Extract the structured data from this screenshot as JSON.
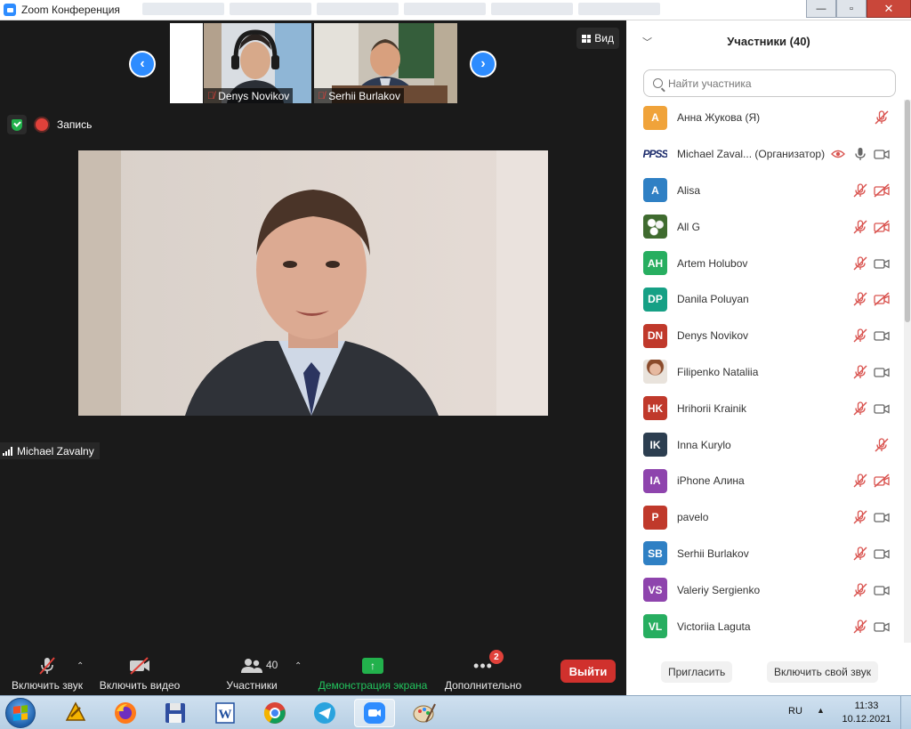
{
  "window": {
    "title": "Zoom Конференция",
    "controls": {
      "minimize": "—",
      "maximize": "▫",
      "close": "✕"
    }
  },
  "meeting": {
    "view_label": "Вид",
    "record_label": "Запись",
    "thumbnails": [
      {
        "name": "Denys Novikov",
        "muted": true
      },
      {
        "name": "Serhii Burlakov",
        "muted": true
      }
    ],
    "active_speaker": "Michael Zavalny"
  },
  "toolbar": {
    "mute_label": "Включить звук",
    "video_label": "Включить видео",
    "participants_label": "Участники",
    "participants_count": "40",
    "share_label": "Демонстрация экрана",
    "more_label": "Дополнительно",
    "more_badge": "2",
    "leave_label": "Выйти"
  },
  "panel": {
    "title": "Участники (40)",
    "search_placeholder": "Найти участника",
    "participants": [
      {
        "name": "Анна Жукова (Я)",
        "initials": "A",
        "color": "#f0a33a",
        "avatar": "initials",
        "mic": "off",
        "video": "none"
      },
      {
        "name": "Michael Zaval... (Организатор)",
        "initials": "PPSS",
        "color": "#1b2a6b",
        "avatar": "logo",
        "mic": "on",
        "video": "on",
        "recording": true
      },
      {
        "name": "Alisa",
        "initials": "A",
        "color": "#2f80c4",
        "avatar": "initials",
        "mic": "off",
        "video": "off"
      },
      {
        "name": "All G",
        "initials": "",
        "color": "#3f6b2f",
        "avatar": "photo-flower",
        "mic": "off",
        "video": "off"
      },
      {
        "name": "Artem Holubov",
        "initials": "AH",
        "color": "#27ae60",
        "avatar": "initials",
        "mic": "off",
        "video": "on"
      },
      {
        "name": "Danila Poluyan",
        "initials": "DP",
        "color": "#16a085",
        "avatar": "initials",
        "mic": "off",
        "video": "off"
      },
      {
        "name": "Denys Novikov",
        "initials": "DN",
        "color": "#c0392b",
        "avatar": "initials",
        "mic": "off",
        "video": "on"
      },
      {
        "name": "Filipenko Nataliia",
        "initials": "",
        "color": "#e9e3dc",
        "avatar": "photo-woman",
        "mic": "off",
        "video": "on"
      },
      {
        "name": "Hrihorii Krainik",
        "initials": "HK",
        "color": "#c0392b",
        "avatar": "initials",
        "mic": "off",
        "video": "on"
      },
      {
        "name": "Inna Kurylo",
        "initials": "IK",
        "color": "#2c3e50",
        "avatar": "initials",
        "mic": "off",
        "video": "none"
      },
      {
        "name": "iPhone Алина",
        "initials": "IA",
        "color": "#8e44ad",
        "avatar": "initials",
        "mic": "off",
        "video": "off"
      },
      {
        "name": "pavelo",
        "initials": "P",
        "color": "#c0392b",
        "avatar": "initials",
        "mic": "off",
        "video": "on"
      },
      {
        "name": "Serhii Burlakov",
        "initials": "SB",
        "color": "#2f80c4",
        "avatar": "initials",
        "mic": "off",
        "video": "on"
      },
      {
        "name": "Valeriy Sergienko",
        "initials": "VS",
        "color": "#8e44ad",
        "avatar": "initials",
        "mic": "off",
        "video": "on"
      },
      {
        "name": "Victoriia Laguta",
        "initials": "VL",
        "color": "#27ae60",
        "avatar": "initials",
        "mic": "off",
        "video": "on"
      }
    ],
    "invite_label": "Пригласить",
    "unmute_self_label": "Включить свой звук"
  },
  "taskbar": {
    "apps": [
      "start-button",
      "winamp-icon",
      "firefox-icon",
      "save-icon",
      "word-icon",
      "chrome-icon",
      "telegram-icon",
      "zoom-icon",
      "paint-icon"
    ],
    "language": "RU",
    "time": "11:33",
    "date": "10.12.2021"
  },
  "colors": {
    "accent": "#2d8cff",
    "danger": "#e0413a",
    "share_green": "#22b14c"
  }
}
